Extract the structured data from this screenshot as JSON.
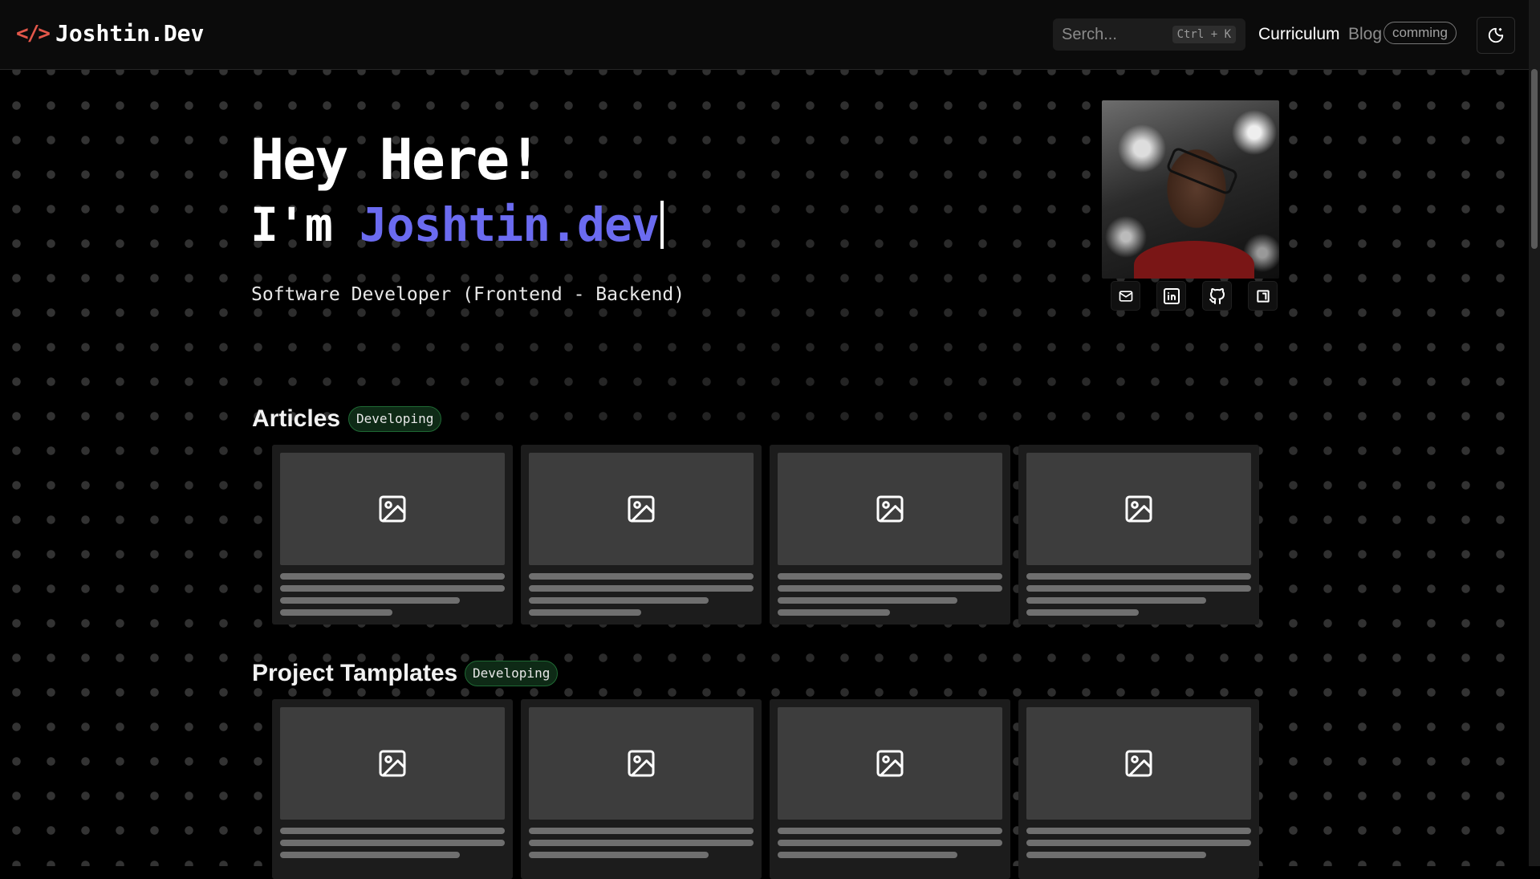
{
  "header": {
    "logo_icon": "</>",
    "logo_text": "Joshtin.Dev",
    "search_placeholder": "Serch...",
    "search_shortcut": "Ctrl + K",
    "nav_curriculum": "Curriculum",
    "nav_blog": "Blog",
    "nav_blog_badge": "comming",
    "theme_icon": "moon-stars-icon"
  },
  "hero": {
    "greeting": "Hey Here!",
    "name_prefix": "I'm ",
    "name_accent": "Joshtin.dev",
    "role": "Software Developer (Frontend - Backend)"
  },
  "socials": [
    "mail-icon",
    "linkedin-icon",
    "github-icon",
    "portfolio-icon"
  ],
  "sections": {
    "articles_title": "Articles",
    "articles_badge": "Developing",
    "templates_title": "Project Tamplates",
    "templates_badge": "Developing"
  },
  "colors": {
    "accent": "#6b6bf0",
    "logo_icon": "#e3574a",
    "badge_bg": "#0e2a16",
    "badge_border": "#1f6a34"
  }
}
